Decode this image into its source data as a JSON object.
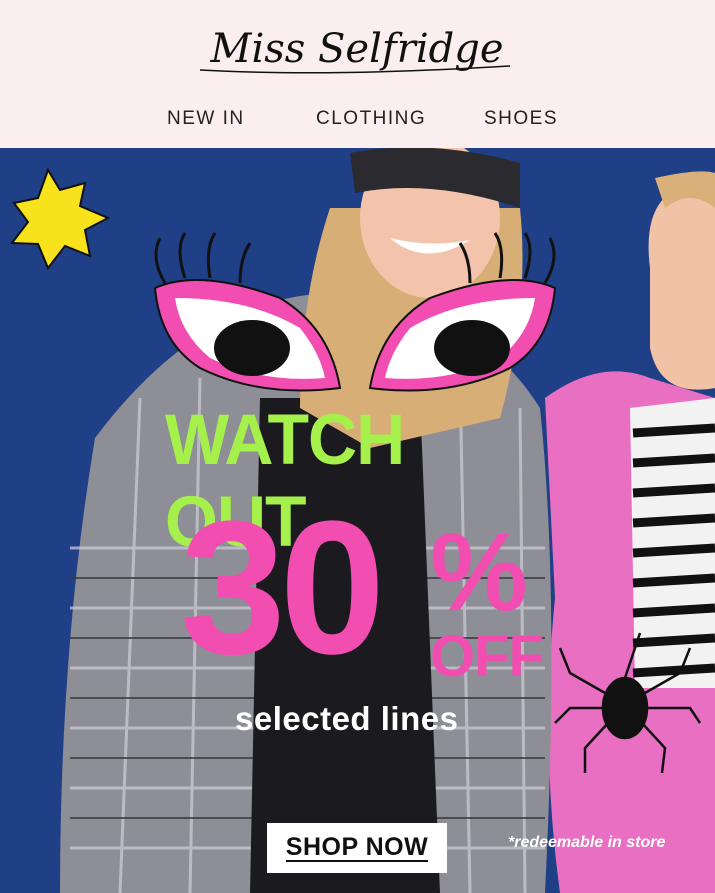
{
  "brand": {
    "logo_text": "Miss Selfridge"
  },
  "nav": {
    "items": [
      {
        "label": "NEW IN"
      },
      {
        "label": "CLOTHING"
      },
      {
        "label": "SHOES"
      }
    ]
  },
  "hero": {
    "headline": "WATCH OUT",
    "discount": "30",
    "percent_sign": "%",
    "off_label": "OFF",
    "subtext": "selected lines",
    "cta_label": "SHOP NOW",
    "footnote": "*redeemable in store"
  },
  "colors": {
    "header_bg": "#fbeef0",
    "hero_bg": "#1f3f86",
    "accent_pink": "#f24db0",
    "headline_green": "#a5f04a",
    "star_yellow": "#f7e21b"
  }
}
